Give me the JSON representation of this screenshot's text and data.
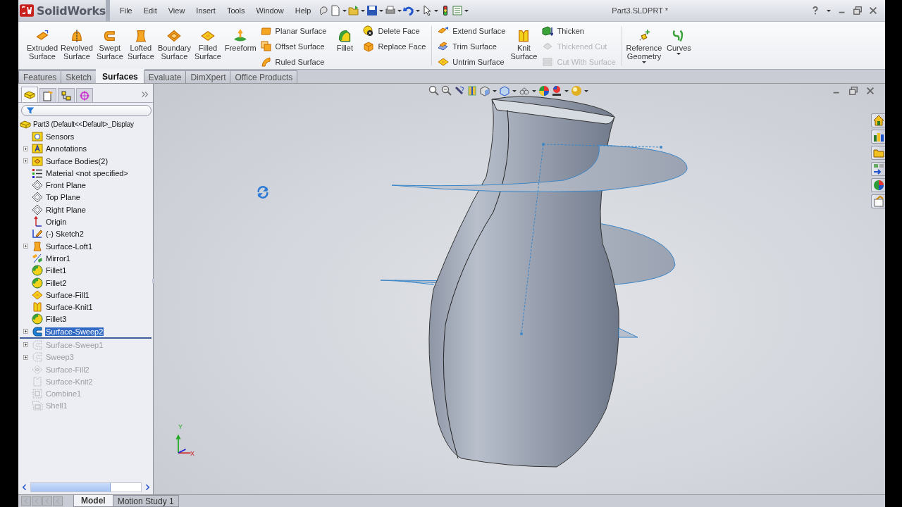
{
  "title_bar": {
    "logo": "SolidWorks",
    "menu": [
      "File",
      "Edit",
      "View",
      "Insert",
      "Tools",
      "Window",
      "Help"
    ],
    "document_title": "Part3.SLDPRT *"
  },
  "ribbon": [
    {
      "kind": "large",
      "items": [
        {
          "label": "Extruded\nSurface",
          "dropdown": false
        },
        {
          "label": "Revolved\nSurface",
          "dropdown": false
        },
        {
          "label": "Swept\nSurface",
          "dropdown": false
        },
        {
          "label": "Lofted\nSurface",
          "dropdown": false
        },
        {
          "label": "Boundary\nSurface",
          "dropdown": false
        },
        {
          "label": "Filled\nSurface",
          "dropdown": false
        },
        {
          "label": "Freeform",
          "dropdown": false
        }
      ]
    },
    {
      "kind": "stack",
      "items": [
        {
          "label": "Planar Surface",
          "disabled": false
        },
        {
          "label": "Offset Surface",
          "disabled": false
        },
        {
          "label": "Ruled Surface",
          "disabled": false
        }
      ]
    },
    {
      "kind": "large",
      "items": [
        {
          "label": "Fillet",
          "dropdown": false
        }
      ]
    },
    {
      "kind": "stack",
      "items": [
        {
          "label": "Delete Face",
          "disabled": false
        },
        {
          "label": "Replace Face",
          "disabled": false
        }
      ]
    },
    {
      "kind": "separator"
    },
    {
      "kind": "stack",
      "items": [
        {
          "label": "Extend Surface",
          "disabled": false
        },
        {
          "label": "Trim Surface",
          "disabled": false
        },
        {
          "label": "Untrim Surface",
          "disabled": false
        }
      ]
    },
    {
      "kind": "large",
      "items": [
        {
          "label": "Knit\nSurface",
          "dropdown": false
        }
      ]
    },
    {
      "kind": "stack",
      "items": [
        {
          "label": "Thicken",
          "disabled": false
        },
        {
          "label": "Thickened Cut",
          "disabled": true
        },
        {
          "label": "Cut With Surface",
          "disabled": true
        }
      ]
    },
    {
      "kind": "separator"
    },
    {
      "kind": "large",
      "items": [
        {
          "label": "Reference\nGeometry",
          "dropdown": true
        },
        {
          "label": "Curves",
          "dropdown": true
        }
      ]
    }
  ],
  "command_tabs": [
    {
      "label": "Features",
      "selected": false
    },
    {
      "label": "Sketch",
      "selected": false
    },
    {
      "label": "Surfaces",
      "selected": true
    },
    {
      "label": "Evaluate",
      "selected": false
    },
    {
      "label": "DimXpert",
      "selected": false
    },
    {
      "label": "Office Products",
      "selected": false
    }
  ],
  "panel_tabs": [
    {
      "selected": true
    },
    {
      "selected": false
    },
    {
      "selected": false
    },
    {
      "selected": false
    }
  ],
  "feature_tree": {
    "label": "Part3 (Default<<Default>_Display",
    "children": [
      {
        "label": "Sensors",
        "expandable": false,
        "selected": false,
        "rolled_back": false
      },
      {
        "label": "Annotations",
        "expandable": true,
        "selected": false,
        "rolled_back": false
      },
      {
        "label": "Surface Bodies(2)",
        "expandable": true,
        "selected": false,
        "rolled_back": false
      },
      {
        "label": "Material <not specified>",
        "expandable": false,
        "selected": false,
        "rolled_back": false
      },
      {
        "label": "Front Plane",
        "expandable": false,
        "selected": false,
        "rolled_back": false
      },
      {
        "label": "Top Plane",
        "expandable": false,
        "selected": false,
        "rolled_back": false
      },
      {
        "label": "Right Plane",
        "expandable": false,
        "selected": false,
        "rolled_back": false
      },
      {
        "label": "Origin",
        "expandable": false,
        "selected": false,
        "rolled_back": false
      },
      {
        "label": "(-) Sketch2",
        "expandable": false,
        "selected": false,
        "rolled_back": false
      },
      {
        "label": "Surface-Loft1",
        "expandable": true,
        "selected": false,
        "rolled_back": false
      },
      {
        "label": "Mirror1",
        "expandable": false,
        "selected": false,
        "rolled_back": false
      },
      {
        "label": "Fillet1",
        "expandable": false,
        "selected": false,
        "rolled_back": false
      },
      {
        "label": "Fillet2",
        "expandable": false,
        "selected": false,
        "rolled_back": false
      },
      {
        "label": "Surface-Fill1",
        "expandable": false,
        "selected": false,
        "rolled_back": false
      },
      {
        "label": "Surface-Knit1",
        "expandable": false,
        "selected": false,
        "rolled_back": false
      },
      {
        "label": "Fillet3",
        "expandable": false,
        "selected": false,
        "rolled_back": false
      },
      {
        "label": "Surface-Sweep2",
        "expandable": true,
        "selected": true,
        "rolled_back": false
      },
      {
        "label": "Surface-Sweep1",
        "expandable": true,
        "selected": false,
        "rolled_back": true
      },
      {
        "label": "Sweep3",
        "expandable": true,
        "selected": false,
        "rolled_back": true
      },
      {
        "label": "Surface-Fill2",
        "expandable": false,
        "selected": false,
        "rolled_back": true
      },
      {
        "label": "Surface-Knit2",
        "expandable": false,
        "selected": false,
        "rolled_back": true
      },
      {
        "label": "Combine1",
        "expandable": false,
        "selected": false,
        "rolled_back": true
      },
      {
        "label": "Shell1",
        "expandable": false,
        "selected": false,
        "rolled_back": true
      }
    ]
  },
  "viewport": {
    "triad": {
      "y": "Y",
      "x": "X"
    }
  },
  "bottom_tabs": [
    {
      "label": "Model",
      "selected": true
    },
    {
      "label": "Motion Study 1",
      "selected": false
    }
  ]
}
